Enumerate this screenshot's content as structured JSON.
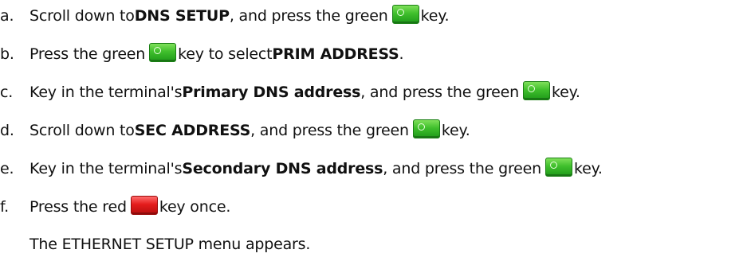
{
  "steps": [
    {
      "marker": "a.",
      "t1": "Scroll down to ",
      "b1": "DNS SETUP",
      "t2": ", and press the green ",
      "t3": " key."
    },
    {
      "marker": "b.",
      "t1": "Press the green ",
      "t2": " key to select ",
      "b1": "PRIM ADDRESS",
      "t3": "."
    },
    {
      "marker": "c.",
      "t1": "Key in the terminal's ",
      "b1": "Primary DNS address",
      "t2": ", and press the green ",
      "t3": " key."
    },
    {
      "marker": "d.",
      "t1": "Scroll down to ",
      "b1": "SEC ADDRESS",
      "t2": ", and press the green ",
      "t3": " key."
    },
    {
      "marker": "e.",
      "t1": "Key in the terminal's ",
      "b1": "Secondary DNS address",
      "t2": ", and press the green ",
      "t3": " key."
    },
    {
      "marker": "f.",
      "t1": "Press the red ",
      "t2": " key once."
    }
  ],
  "note": "The ETHERNET SETUP menu appears.",
  "keys": {
    "green_icon": "green-enter-key-icon",
    "red_icon": "red-cancel-key-icon",
    "green_color": "#3fbf2c",
    "red_color": "#e41c1c",
    "green_glyph": "o",
    "red_glyph": "X"
  }
}
